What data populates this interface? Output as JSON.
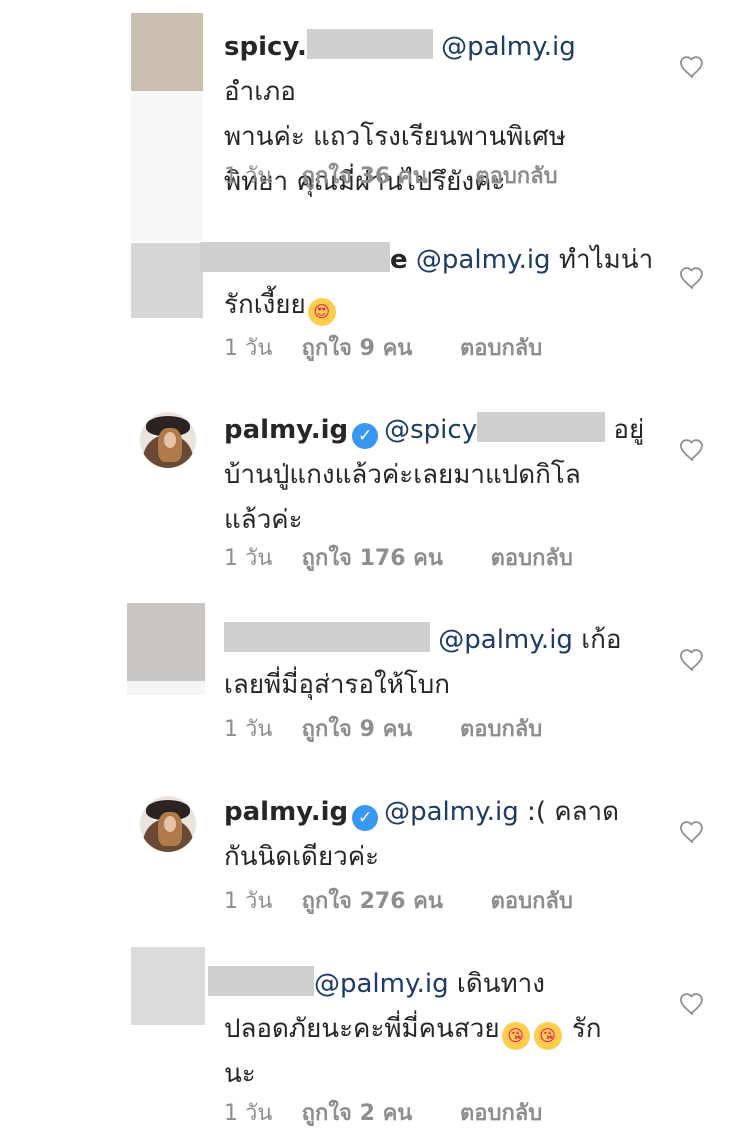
{
  "comments": [
    {
      "username": "spicy.",
      "mention": "@palmy.ig",
      "text_line1": " อำเภอ",
      "text_line2": "พานค่ะ แถวโรงเรียนพานพิเศษ",
      "text_line3": "พิทยา คุณมี่ผ่านไปรึยังคะ",
      "age": "1 วัน",
      "likes": "ถูกใจ 36 คน",
      "reply": "ตอบกลับ"
    },
    {
      "username": "e",
      "mention": "@palmy.ig",
      "text_line1": " ทำไมน่า",
      "text_line2": "รักเงี้ยย",
      "age": "1 วัน",
      "likes": "ถูกใจ 9 คน",
      "reply": "ตอบกลับ"
    },
    {
      "username": "palmy.ig",
      "verified": "✓",
      "mention": "@spicy",
      "text_line1": " อยู่",
      "text_line2": "บ้านปู่แกงแล้วค่ะเลยมาแปดกิโล",
      "text_line3": "แล้วค่ะ",
      "age": "1 วัน",
      "likes": "ถูกใจ 176 คน",
      "reply": "ตอบกลับ"
    },
    {
      "mention": "@palmy.ig",
      "text_line1": " เก้อ",
      "text_line2": "เลยพี่มี่อุส่ารอให้โบก",
      "age": "1 วัน",
      "likes": "ถูกใจ 9 คน",
      "reply": "ตอบกลับ"
    },
    {
      "username": "palmy.ig",
      "verified": "✓",
      "mention": "@palmy.ig",
      "text_line1": " :( คลาด",
      "text_line2": "กันนิดเดียวค่ะ",
      "age": "1 วัน",
      "likes": "ถูกใจ 276 คน",
      "reply": "ตอบกลับ"
    },
    {
      "mention": "@palmy.ig",
      "text_line1": " เดินทาง",
      "text_line2": "ปลอดภัยนะคะพี่มี่คนสวย",
      "text_line2_end": " รัก",
      "text_line3": "นะ",
      "age": "1 วัน",
      "likes": "ถูกใจ 2 คน",
      "reply": "ตอบกลับ"
    }
  ],
  "emojis": {
    "heart_eyes": "😍",
    "kissing_heart": "😘"
  },
  "colors": {
    "mention": "#1d3b66",
    "meta": "#8e8e8e",
    "verified": "#3897f0"
  }
}
